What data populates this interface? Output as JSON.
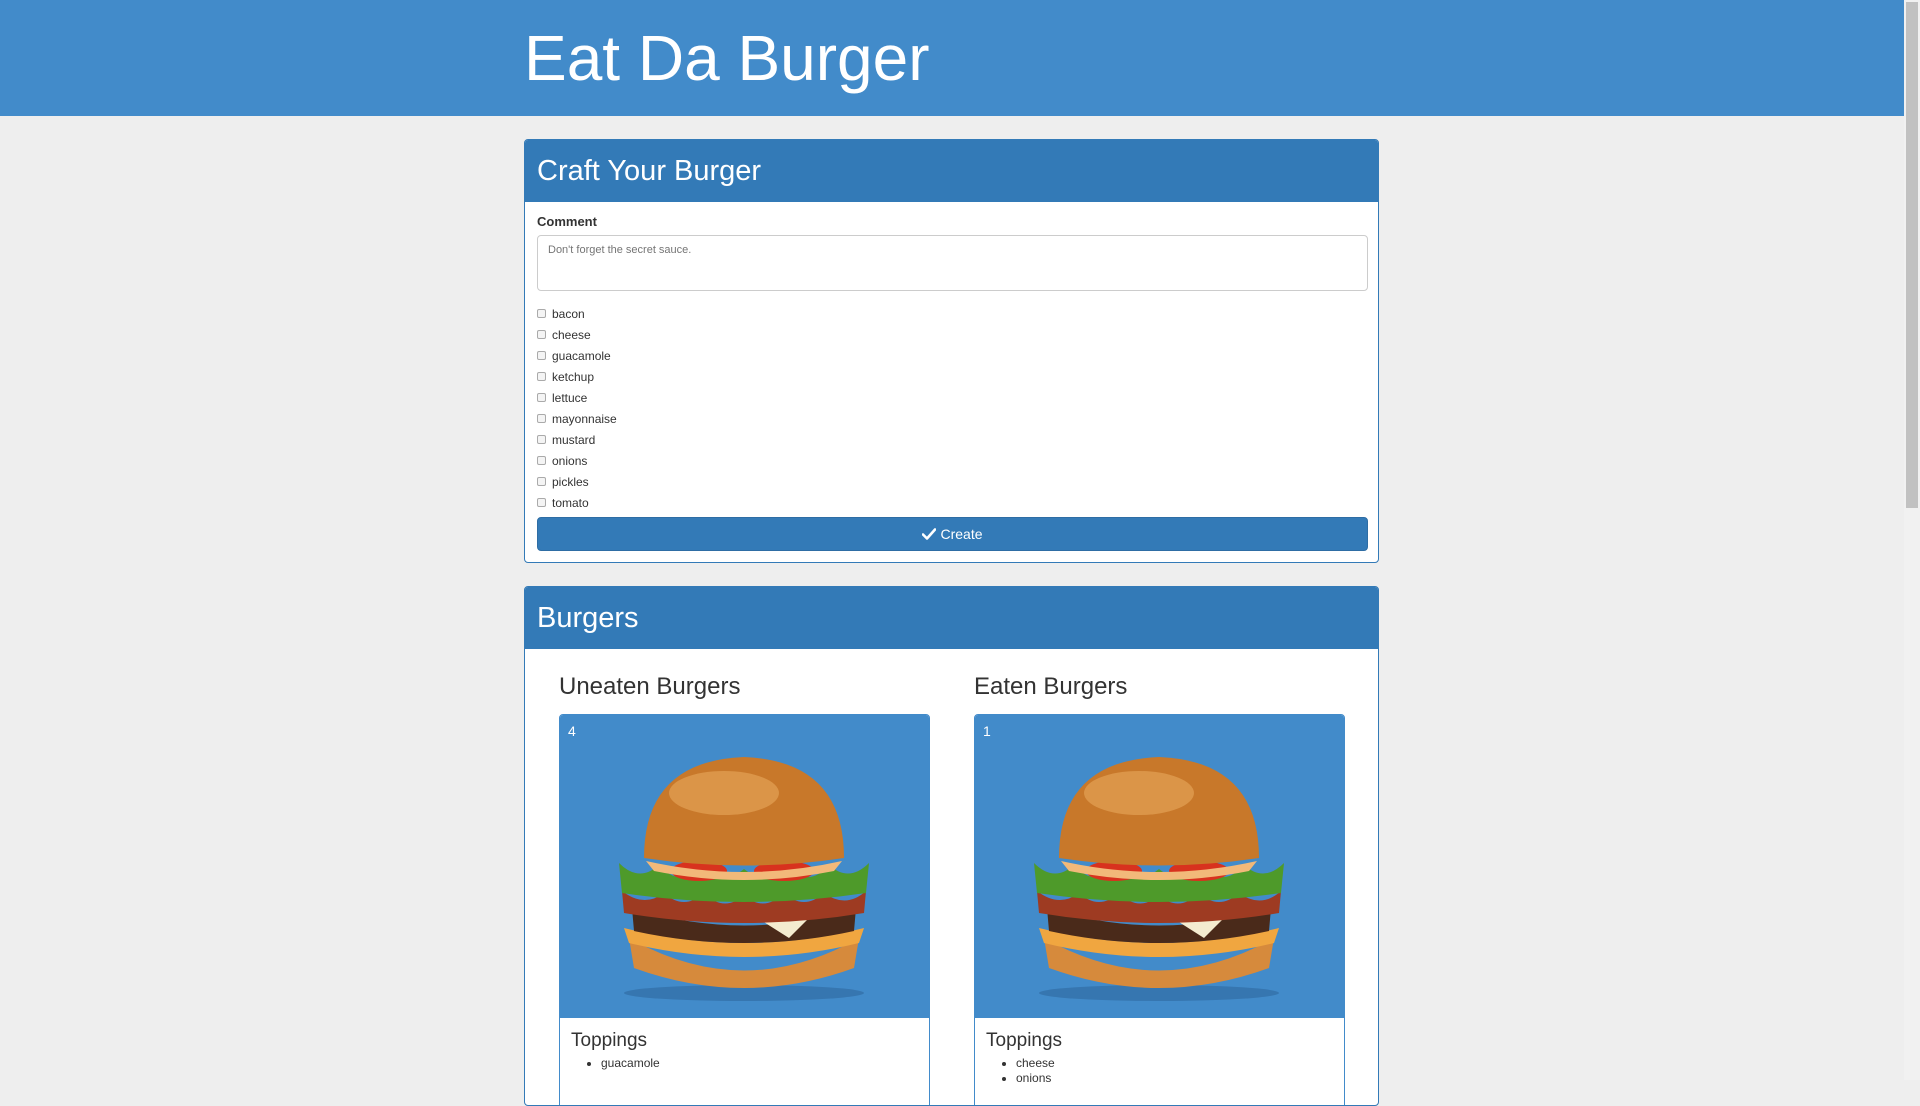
{
  "header": {
    "title": "Eat Da Burger"
  },
  "craft": {
    "title": "Craft Your Burger",
    "comment_label": "Comment",
    "comment_placeholder": "Don't forget the secret sauce.",
    "toppings": [
      "bacon",
      "cheese",
      "guacamole",
      "ketchup",
      "lettuce",
      "mayonnaise",
      "mustard",
      "onions",
      "pickles",
      "tomato"
    ],
    "create_label": "Create"
  },
  "burgers": {
    "title": "Burgers",
    "uneaten": {
      "title": "Uneaten Burgers",
      "card": {
        "id": "4",
        "toppings_title": "Toppings",
        "toppings": [
          "guacamole"
        ]
      }
    },
    "eaten": {
      "title": "Eaten Burgers",
      "card": {
        "id": "1",
        "toppings_title": "Toppings",
        "toppings": [
          "cheese",
          "onions"
        ]
      }
    }
  },
  "colors": {
    "primary": "#428bca",
    "panel": "#337ab7",
    "background": "#eeeeee"
  },
  "icons": {
    "create": "check-icon"
  }
}
